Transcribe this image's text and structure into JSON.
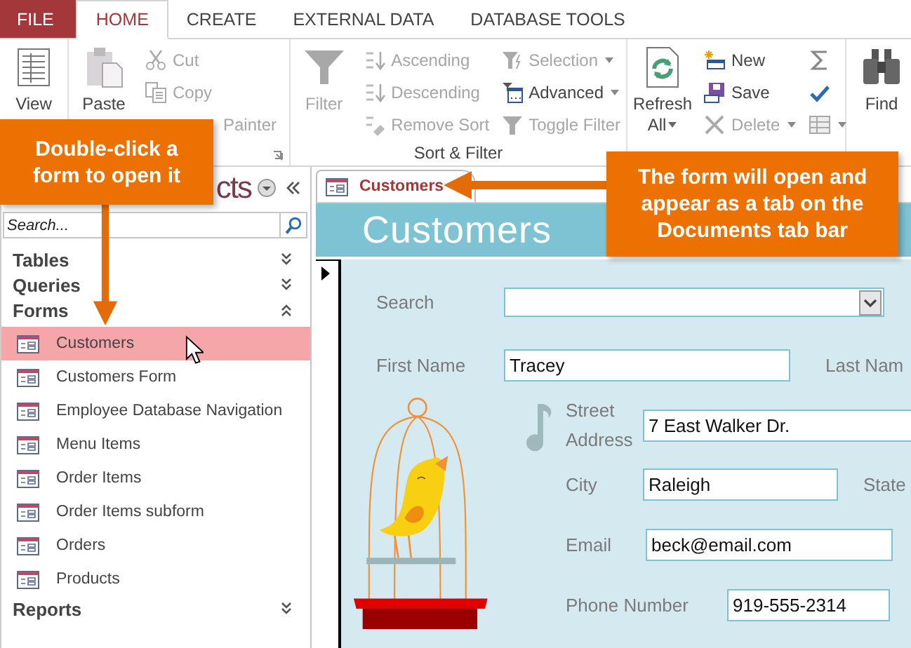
{
  "ribbon": {
    "tabs": [
      {
        "label": "FILE",
        "kind": "file",
        "selected": false
      },
      {
        "label": "HOME",
        "kind": "tab",
        "selected": true
      },
      {
        "label": "CREATE",
        "kind": "tab",
        "selected": false
      },
      {
        "label": "EXTERNAL DATA",
        "kind": "tab",
        "selected": false
      },
      {
        "label": "DATABASE TOOLS",
        "kind": "tab",
        "selected": false
      }
    ],
    "groups": [
      {
        "large": [
          {
            "label": "View",
            "kind": "view",
            "disabled": false
          }
        ]
      },
      {
        "launcher": true,
        "large": [
          {
            "label": "Paste",
            "kind": "paste",
            "disabled": false
          }
        ],
        "columns": [
          [
            {
              "label": "Cut",
              "kind": "cut",
              "disabled": true
            },
            {
              "label": "Copy",
              "kind": "copy",
              "disabled": true
            },
            {
              "label": "Painter",
              "kind": "painter",
              "disabled": true
            }
          ]
        ]
      },
      {
        "label": "Sort & Filter",
        "large": [
          {
            "label": "Filter",
            "kind": "filter",
            "disabled": true
          }
        ],
        "columns": [
          [
            {
              "label": "Ascending",
              "kind": "ascending",
              "disabled": true
            },
            {
              "label": "Descending",
              "kind": "descending",
              "disabled": true
            },
            {
              "label": "Remove Sort",
              "kind": "removesort",
              "disabled": true
            }
          ],
          [
            {
              "label": "Selection",
              "kind": "selection",
              "disabled": true,
              "dropdown": true
            },
            {
              "label": "Advanced",
              "kind": "advanced",
              "disabled": false,
              "dropdown": true
            },
            {
              "label": "Toggle Filter",
              "kind": "toggle",
              "disabled": true
            }
          ]
        ]
      },
      {
        "large": [
          {
            "label": "Refresh All",
            "kind": "refresh",
            "disabled": false,
            "dropdown": true
          }
        ],
        "columns": [
          [
            {
              "label": "New",
              "kind": "new",
              "disabled": false
            },
            {
              "label": "Save",
              "kind": "save",
              "disabled": false
            },
            {
              "label": "Delete",
              "kind": "delete",
              "disabled": true,
              "dropdown": true
            }
          ],
          [
            {
              "kind": "totals"
            },
            {
              "kind": "spelling"
            },
            {
              "kind": "more",
              "dropdown": true
            }
          ]
        ]
      },
      {
        "large": [
          {
            "label": "Find",
            "kind": "find",
            "disabled": false
          }
        ]
      }
    ]
  },
  "navigation_pane": {
    "title": "cts",
    "search": {
      "placeholder": "Search..."
    },
    "groups": [
      {
        "label": "Tables",
        "expanded": false
      },
      {
        "label": "Queries",
        "expanded": false
      },
      {
        "label": "Forms",
        "expanded": true,
        "items": [
          {
            "label": "Customers",
            "selected": true
          },
          {
            "label": "Customers Form",
            "selected": false
          },
          {
            "label": "Employee Database Navigation",
            "selected": false
          },
          {
            "label": "Menu Items",
            "selected": false
          },
          {
            "label": "Order Items",
            "selected": false
          },
          {
            "label": "Order Items  subform",
            "selected": false
          },
          {
            "label": "Orders",
            "selected": false
          },
          {
            "label": "Products",
            "selected": false
          }
        ]
      },
      {
        "label": "Reports",
        "expanded": false
      }
    ]
  },
  "document_tabs": [
    {
      "label": "Customers",
      "selected": true
    }
  ],
  "form": {
    "title": "Customers",
    "search": {
      "label": "Search"
    },
    "first_name": {
      "label": "First Name",
      "value": "Tracey"
    },
    "last_name": {
      "label": "Last Nam"
    },
    "street_address": {
      "label": "Street Address",
      "value": "7 East Walker Dr."
    },
    "city": {
      "label": "City",
      "value": "Raleigh"
    },
    "state": {
      "label": "State"
    },
    "email": {
      "label": "Email",
      "value": "beck@email.com"
    },
    "phone_number": {
      "label": "Phone Number",
      "value": "919-555-2314"
    }
  },
  "callouts": [
    {
      "text": "Double-click a form to open it"
    },
    {
      "text": "The form will open and appear as a tab on the Documents tab bar"
    }
  ]
}
